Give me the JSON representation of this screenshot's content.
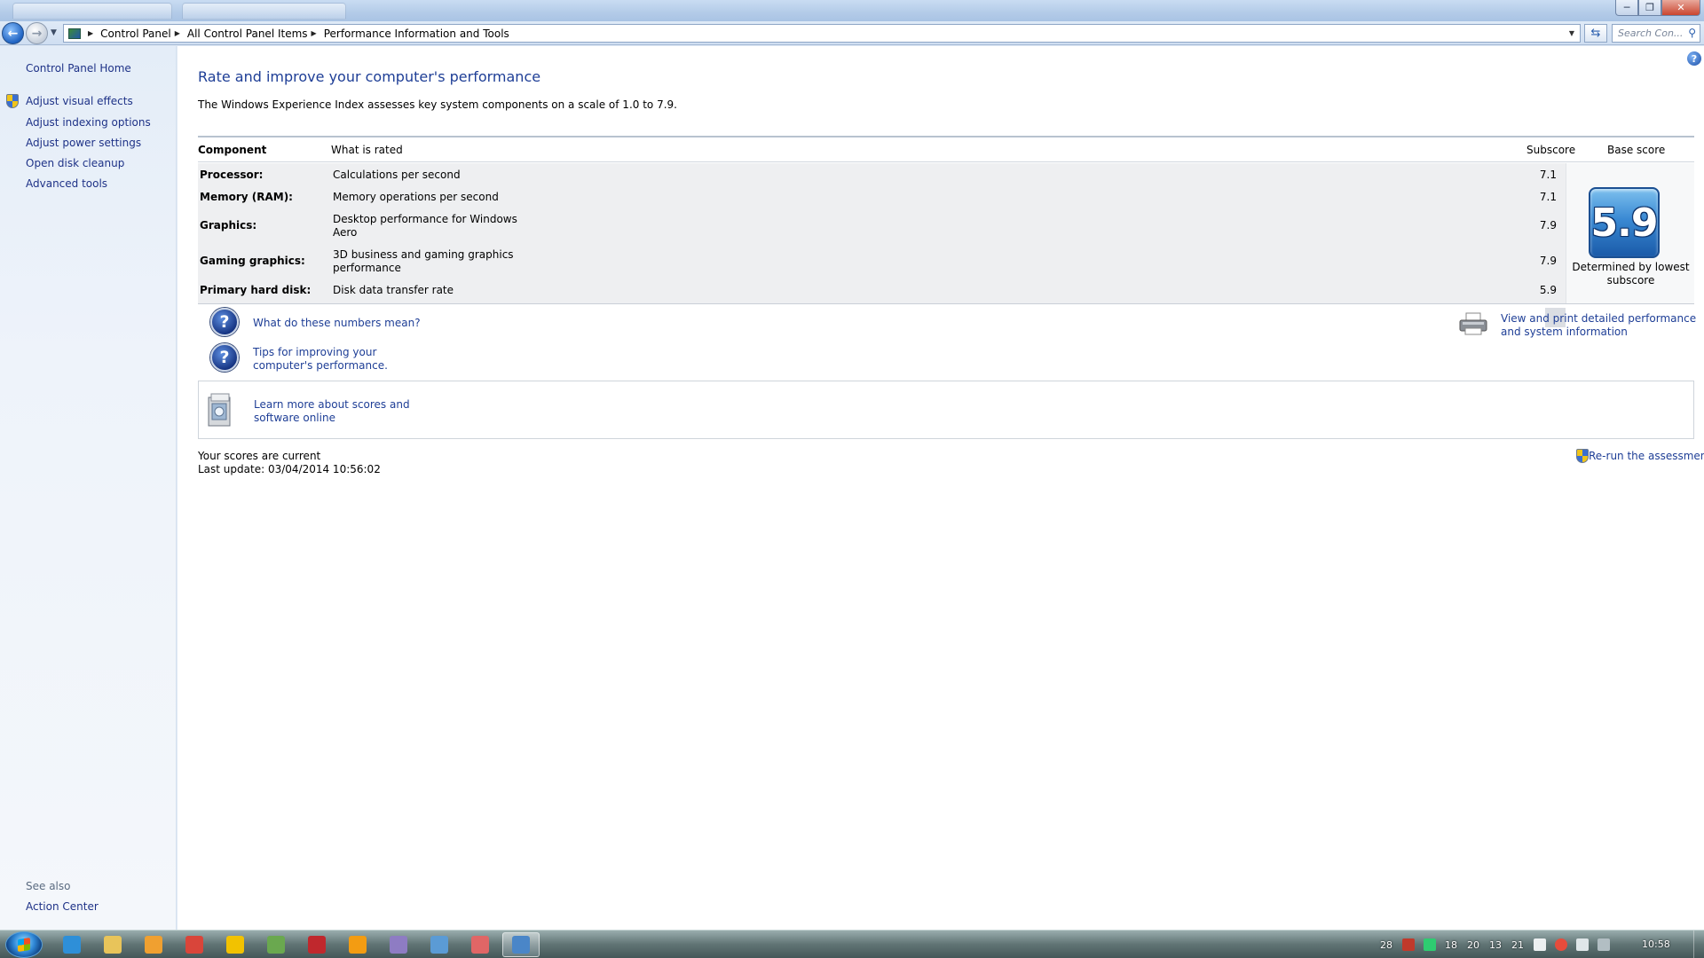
{
  "window": {
    "minimize_glyph": "─",
    "maximize_glyph": "❐",
    "close_glyph": "✕"
  },
  "address": {
    "breadcrumbs": [
      "Control Panel",
      "All Control Panel Items",
      "Performance Information and Tools"
    ],
    "search_placeholder": "Search Con..."
  },
  "sidebar": {
    "home": "Control Panel Home",
    "items": [
      {
        "label": "Adjust visual effects"
      },
      {
        "label": "Adjust indexing options"
      },
      {
        "label": "Adjust power settings"
      },
      {
        "label": "Open disk cleanup"
      },
      {
        "label": "Advanced tools"
      }
    ],
    "see_also_label": "See also",
    "see_also_items": [
      {
        "label": "Action Center"
      }
    ]
  },
  "main": {
    "title": "Rate and improve your computer's performance",
    "description": "The Windows Experience Index assesses key system components on a scale of 1.0 to 7.9.",
    "table": {
      "headers": {
        "component": "Component",
        "rated": "What is rated",
        "subscore": "Subscore",
        "base": "Base score"
      },
      "rows": [
        {
          "component": "Processor:",
          "rated": "Calculations per second",
          "subscore": "7.1"
        },
        {
          "component": "Memory (RAM):",
          "rated": "Memory operations per second",
          "subscore": "7.1"
        },
        {
          "component": "Graphics:",
          "rated": "Desktop performance for Windows Aero",
          "subscore": "7.9"
        },
        {
          "component": "Gaming graphics:",
          "rated": "3D business and gaming graphics performance",
          "subscore": "7.9"
        },
        {
          "component": "Primary hard disk:",
          "rated": "Disk data transfer rate",
          "subscore": "5.9"
        }
      ],
      "base_score": "5.9",
      "base_note": "Determined by lowest subscore"
    },
    "links": {
      "numbers": "What do these numbers mean?",
      "tips": "Tips for improving your computer's performance.",
      "print": "View and print detailed performance and system information",
      "learn": "Learn more about scores and software online",
      "rerun": "Re-run the assessment"
    },
    "status": {
      "current": "Your scores are current",
      "last_update": "Last update: 03/04/2014 10:56:02"
    }
  },
  "taskbar": {
    "apps": [
      {
        "icon": "internet-explorer-icon",
        "color": "#2e8fd8"
      },
      {
        "icon": "file-explorer-icon",
        "color": "#e8c45a"
      },
      {
        "icon": "media-player-icon",
        "color": "#f0a030"
      },
      {
        "icon": "chrome-icon",
        "color": "#d9453a"
      },
      {
        "icon": "outlook-icon",
        "color": "#f2c200"
      },
      {
        "icon": "network-app-icon",
        "color": "#6aa84f"
      },
      {
        "icon": "filezilla-icon",
        "color": "#c0282d"
      },
      {
        "icon": "sun-app-icon",
        "color": "#f39c12"
      },
      {
        "icon": "image-app-icon",
        "color": "#8e7cc3"
      },
      {
        "icon": "user-accounts-icon",
        "color": "#5b9bd5"
      },
      {
        "icon": "paint-icon",
        "color": "#e06666"
      },
      {
        "icon": "control-panel-icon",
        "color": "#4a86c8"
      }
    ],
    "tray_numbers": [
      "28",
      "18",
      "20",
      "13",
      "21"
    ],
    "clock": "10:58"
  }
}
